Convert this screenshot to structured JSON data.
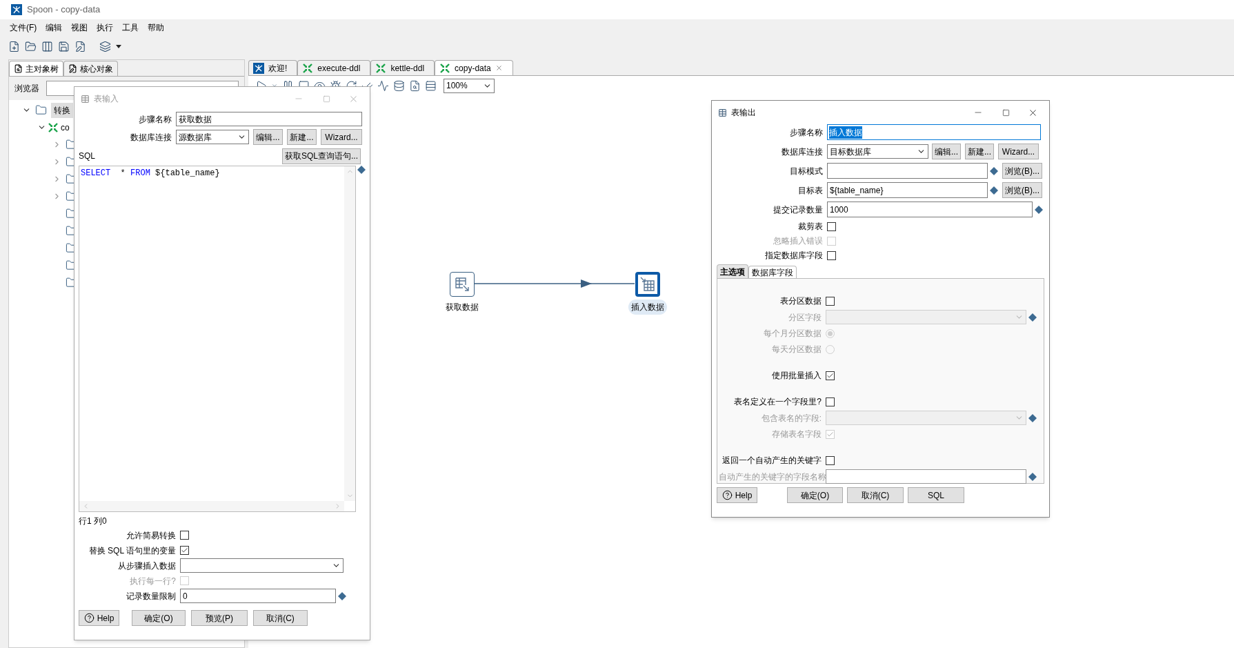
{
  "window": {
    "title": "Spoon - copy-data"
  },
  "menu": [
    "文件(F)",
    "编辑",
    "视图",
    "执行",
    "工具",
    "帮助"
  ],
  "left_panel": {
    "tabs": [
      {
        "label": "主对象树",
        "selected": true
      },
      {
        "label": "核心对象",
        "selected": false
      }
    ],
    "browser_label": "浏览器",
    "tree": [
      {
        "label": "转换",
        "selected": true,
        "expanded": true,
        "children": [
          {
            "label": "co",
            "selected": false,
            "expanded": true,
            "children": [
              {
                "has_children": true
              },
              {
                "has_children": true
              },
              {
                "has_children": true
              },
              {
                "has_children": true
              },
              {
                "has_children": false
              },
              {
                "has_children": false
              },
              {
                "has_children": false
              },
              {
                "has_children": false
              },
              {
                "has_children": false
              }
            ]
          }
        ]
      }
    ]
  },
  "editor_tabs": [
    {
      "label": "欢迎!",
      "kind": "welcome",
      "selected": false,
      "closable": false
    },
    {
      "label": "execute-ddl",
      "kind": "transformation",
      "selected": false,
      "closable": false
    },
    {
      "label": "kettle-ddl",
      "kind": "transformation",
      "selected": false,
      "closable": false
    },
    {
      "label": "copy-data",
      "kind": "transformation",
      "selected": true,
      "closable": true
    }
  ],
  "zoom": "100%",
  "canvas": {
    "steps": [
      {
        "label": "获取数据",
        "kind": "input",
        "selected": false
      },
      {
        "label": "插入数据",
        "kind": "output",
        "selected": true
      }
    ]
  },
  "table_input_dialog": {
    "title": "表输入",
    "step_name_label": "步骤名称",
    "step_name": "获取数据",
    "connection_label": "数据库连接",
    "connection": "源数据库",
    "connection_buttons": [
      "编辑...",
      "新建...",
      "Wizard..."
    ],
    "sql_label": "SQL",
    "get_sql_button": "获取SQL查询语句...",
    "sql": [
      {
        "text": "SELECT",
        "kind": "keyword"
      },
      {
        "text": "  * ",
        "kind": "plain"
      },
      {
        "text": "FROM",
        "kind": "keyword"
      },
      {
        "text": " ${table_name}",
        "kind": "plain"
      }
    ],
    "cursor_position": "行1 列0",
    "options": [
      {
        "label": "允许简易转换",
        "kind": "checkbox",
        "checked": false,
        "disabled": false
      },
      {
        "label": "替换 SQL 语句里的变量",
        "kind": "checkbox",
        "checked": true,
        "disabled": false
      },
      {
        "label": "从步骤插入数据",
        "kind": "select",
        "disabled": false
      },
      {
        "label": "执行每一行?",
        "kind": "checkbox",
        "checked": false,
        "disabled": true
      },
      {
        "label": "记录数量限制",
        "kind": "text",
        "value": "0",
        "disabled": false
      }
    ],
    "buttons": [
      {
        "label": "Help",
        "kind": "help"
      },
      {
        "label": "确定(O)",
        "kind": "plain"
      },
      {
        "label": "预览(P)",
        "kind": "plain"
      },
      {
        "label": "取消(C)",
        "kind": "plain"
      }
    ]
  },
  "table_output_dialog": {
    "title": "表输出",
    "fields": [
      {
        "label": "步骤名称",
        "kind": "text",
        "value": "插入数据",
        "highlighted": true,
        "disabled": false
      },
      {
        "label": "数据库连接",
        "kind": "connection",
        "value": "目标数据库",
        "buttons": [
          "编辑...",
          "新建...",
          "Wizard..."
        ]
      },
      {
        "label": "目标模式",
        "kind": "browse",
        "button": "浏览(B)..."
      },
      {
        "label": "目标表",
        "kind": "browse",
        "value": "${table_name}",
        "button": "浏览(B)..."
      },
      {
        "label": "提交记录数量",
        "kind": "variable",
        "value": "1000",
        "disabled": false
      },
      {
        "label": "裁剪表",
        "kind": "checkbox",
        "checked": false,
        "disabled": false
      },
      {
        "label": "忽略插入错误",
        "kind": "checkbox",
        "checked": false,
        "disabled": true
      },
      {
        "label": "指定数据库字段",
        "kind": "checkbox",
        "checked": false,
        "disabled": false
      }
    ],
    "tabs": [
      {
        "label": "主选项",
        "selected": true
      },
      {
        "label": "数据库字段",
        "selected": false
      }
    ],
    "groups": [
      {
        "rows": [
          {
            "label": "表分区数据",
            "kind": "checkbox",
            "checked": false,
            "disabled": false
          },
          {
            "label": "分区字段",
            "kind": "select",
            "disabled": true
          },
          {
            "label": "每个月分区数据",
            "kind": "radio",
            "selected": true,
            "disabled": true
          },
          {
            "label": "每天分区数据",
            "kind": "radio",
            "selected": false,
            "disabled": true
          }
        ]
      },
      {
        "rows": [
          {
            "label": "使用批量插入",
            "kind": "checkbox",
            "checked": true,
            "disabled": false
          }
        ]
      },
      {
        "rows": [
          {
            "label": "表名定义在一个字段里?",
            "kind": "checkbox",
            "checked": false,
            "disabled": false
          },
          {
            "label": "包含表名的字段:",
            "kind": "select",
            "disabled": true
          },
          {
            "label": "存储表名字段",
            "kind": "checkbox",
            "checked": true,
            "disabled": true
          }
        ]
      },
      {
        "rows": [
          {
            "label": "返回一个自动产生的关键字",
            "kind": "checkbox",
            "checked": false,
            "disabled": false
          },
          {
            "label": "自动产生的关键字的字段名称",
            "kind": "text",
            "disabled": true
          }
        ]
      }
    ],
    "buttons": [
      {
        "label": "Help",
        "kind": "help"
      },
      {
        "label": "确定(O)",
        "kind": "plain"
      },
      {
        "label": "取消(C)",
        "kind": "plain"
      },
      {
        "label": "SQL",
        "kind": "plain"
      }
    ]
  }
}
